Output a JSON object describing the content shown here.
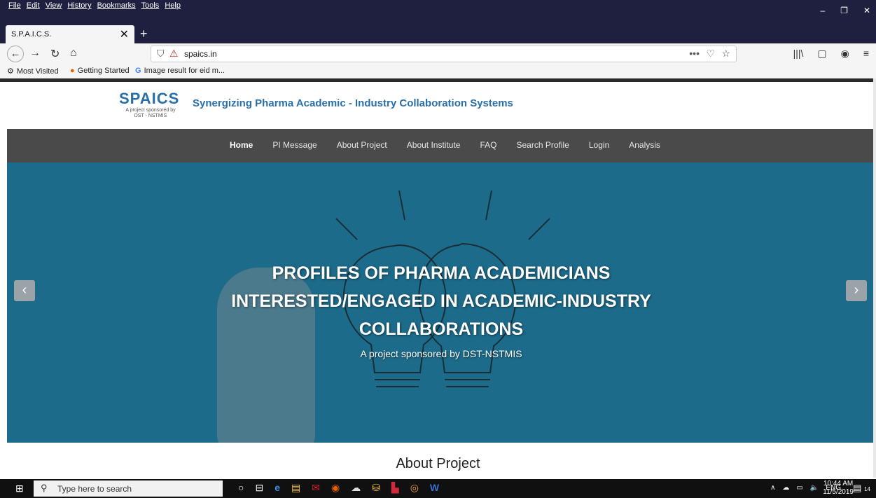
{
  "browser": {
    "menu": [
      "File",
      "Edit",
      "View",
      "History",
      "Bookmarks",
      "Tools",
      "Help"
    ],
    "window_controls": [
      "–",
      "❐",
      "✕"
    ],
    "tab": {
      "title": "S.P.A.I.C.S.",
      "close": "✕"
    },
    "new_tab": "+",
    "url": "spaics.in",
    "nav": {
      "back": "←",
      "forward": "→",
      "reload": "↻",
      "home": "⌂"
    },
    "toolbar_right": [
      "•••",
      "♡",
      "☆"
    ],
    "sidebar_right": [
      "|||\\",
      "▢",
      "◉",
      "≡"
    ],
    "bookmarks": [
      {
        "label": "Most Visited",
        "icon": "⚙"
      },
      {
        "label": "Getting Started",
        "icon": "●"
      },
      {
        "label": "Image result for eid m...",
        "icon": "G"
      }
    ]
  },
  "site": {
    "logo": {
      "title": "SPAICS",
      "sub1": "A project sponsored by",
      "sub2": "DST - NSTMIS"
    },
    "tagline": "Synergizing Pharma Academic - Industry Collaboration Systems",
    "nav": [
      "Home",
      "PI Message",
      "About Project",
      "About Institute",
      "FAQ",
      "Search Profile",
      "Login",
      "Analysis"
    ],
    "hero": {
      "title": "PROFILES OF PHARMA ACADEMICIANS INTERESTED/ENGAGED IN ACADEMIC-INDUSTRY COLLABORATIONS",
      "subtitle": "A project sponsored by DST-NSTMIS",
      "prev": "‹",
      "next": "›"
    },
    "about_heading": "About Project"
  },
  "taskbar": {
    "start": "⊞",
    "search_icon": "⚲",
    "search_placeholder": "Type here to search",
    "cortana": "○",
    "taskview": "⊟",
    "apps": [
      "e",
      "▤",
      "✉",
      "◉",
      "☁",
      "⛁",
      "▙",
      "◎",
      "W"
    ],
    "tray": [
      "∧",
      "☁",
      "▭",
      "🔈",
      "ENG"
    ],
    "time": "10:44 AM",
    "date": "11/5/2019",
    "notifications": "▤",
    "badge": "14"
  }
}
